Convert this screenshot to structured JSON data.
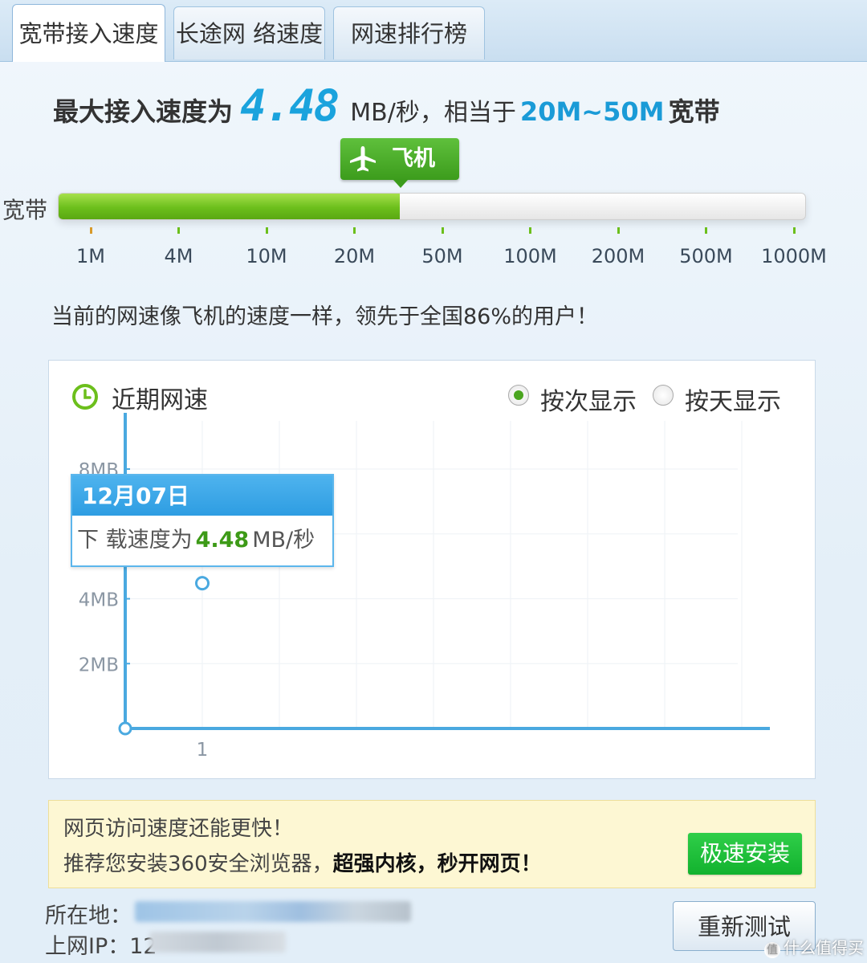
{
  "tabs": [
    {
      "label": "宽带接入速度",
      "active": true
    },
    {
      "label": "长途网 络速度",
      "active": false
    },
    {
      "label": "网速排行榜",
      "active": false
    }
  ],
  "headline": {
    "prefix": "最大接入速度为",
    "speed": "4.48",
    "unit": "MB/秒，相当于",
    "range": "20M~50M",
    "suffix": "宽带"
  },
  "badge": {
    "label": "飞机",
    "icon": "airplane-icon",
    "color": "#4aaa25"
  },
  "speed_bar": {
    "label": "宽带",
    "ticks": [
      "1M",
      "4M",
      "10M",
      "20M",
      "50M",
      "100M",
      "200M",
      "500M",
      "1000M"
    ],
    "fill_fraction": 0.457,
    "fill_color": "#6cbf1c"
  },
  "status_text": "当前的网速像飞机的速度一样，领先于全国86%的用户！",
  "recent": {
    "title": "近期网速",
    "icon": "clock-icon",
    "radio_by_count": "按次显示",
    "radio_by_day": "按天显示",
    "selected": "by_count"
  },
  "chart_data": {
    "type": "line",
    "x": [
      1
    ],
    "series": [
      {
        "values": [
          4.48
        ]
      }
    ],
    "x_ticks": [
      "1"
    ],
    "y_ticks": [
      "2MB",
      "4MB",
      "8MB"
    ],
    "ylim": [
      0,
      8
    ],
    "grid": true,
    "tooltip": {
      "date": "12月07日",
      "prefix": "下 载速度为",
      "value": "4.48",
      "unit": "MB/秒"
    }
  },
  "promo": {
    "line1": "网页访问速度还能更快！",
    "line2": "推荐您安装360安全浏览器，",
    "line2_strong": "超强内核，秒开网页！",
    "button": "极速安装"
  },
  "footer": {
    "location_label": "所在地：",
    "ip_label": "上网IP：12",
    "retest_button": "重新测试",
    "watermark": "什么值得买"
  }
}
